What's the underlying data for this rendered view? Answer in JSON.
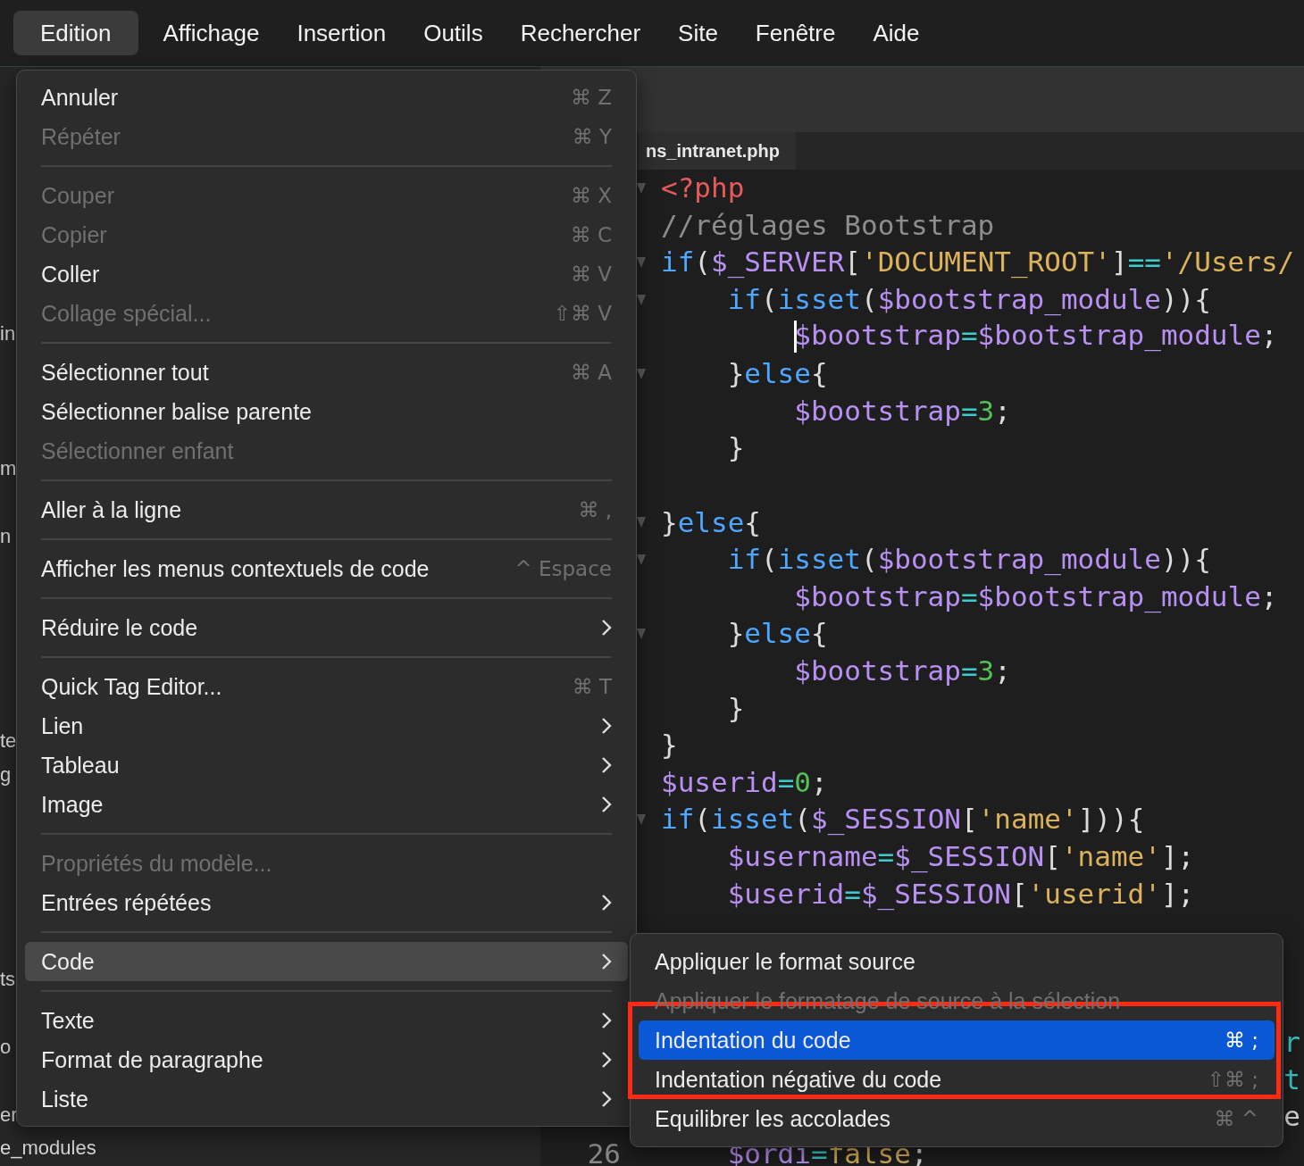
{
  "menubar": [
    {
      "label": "Edition",
      "selected": true
    },
    {
      "label": "Affichage",
      "selected": false
    },
    {
      "label": "Insertion",
      "selected": false
    },
    {
      "label": "Outils",
      "selected": false
    },
    {
      "label": "Rechercher",
      "selected": false
    },
    {
      "label": "Site",
      "selected": false
    },
    {
      "label": "Fenêtre",
      "selected": false
    },
    {
      "label": "Aide",
      "selected": false
    }
  ],
  "sidebar": {
    "items": [
      "in",
      "m",
      "n",
      "te",
      "g",
      "ts",
      "o",
      "er",
      "e_modules"
    ]
  },
  "editor": {
    "tab": {
      "label": "ns_intranet.php"
    },
    "lines": [
      {
        "fold": true,
        "tokens": [
          {
            "kind": "tag",
            "text": "<?php"
          }
        ]
      },
      {
        "fold": false,
        "tokens": [
          {
            "kind": "comment",
            "text": "//réglages Bootstrap"
          }
        ]
      },
      {
        "fold": true,
        "tokens": [
          {
            "kind": "keyword",
            "text": "if"
          },
          {
            "kind": "punct",
            "text": "("
          },
          {
            "kind": "variable",
            "text": "$_SERVER"
          },
          {
            "kind": "punct",
            "text": "["
          },
          {
            "kind": "string",
            "text": "'DOCUMENT_ROOT'"
          },
          {
            "kind": "punct",
            "text": "]"
          },
          {
            "kind": "operator",
            "text": "=="
          },
          {
            "kind": "string",
            "text": "'/Users/"
          }
        ],
        "children": [
          {
            "fold": true,
            "tokens": [
              {
                "kind": "keyword",
                "text": "if"
              },
              {
                "kind": "punct",
                "text": "("
              },
              {
                "kind": "keyword",
                "text": "isset"
              },
              {
                "kind": "punct",
                "text": "("
              },
              {
                "kind": "variable",
                "text": "$bootstrap_module"
              },
              {
                "kind": "punct",
                "text": ")){"
              }
            ],
            "children": [
              {
                "fold": false,
                "cursor": true,
                "tokens": [
                  {
                    "kind": "variable",
                    "text": "$bootstrap"
                  },
                  {
                    "kind": "operator",
                    "text": "="
                  },
                  {
                    "kind": "variable",
                    "text": "$bootstrap_module"
                  },
                  {
                    "kind": "punct",
                    "text": ";"
                  }
                ]
              }
            ]
          },
          {
            "fold": true,
            "tokens": [
              {
                "kind": "punct",
                "text": "}"
              },
              {
                "kind": "keyword",
                "text": "else"
              },
              {
                "kind": "punct",
                "text": "{"
              }
            ],
            "children": [
              {
                "fold": false,
                "tokens": [
                  {
                    "kind": "variable",
                    "text": "$bootstrap"
                  },
                  {
                    "kind": "operator",
                    "text": "="
                  },
                  {
                    "kind": "number",
                    "text": "3"
                  },
                  {
                    "kind": "punct",
                    "text": ";"
                  }
                ]
              }
            ]
          },
          {
            "fold": false,
            "tokens": [
              {
                "kind": "punct",
                "text": "}"
              }
            ]
          }
        ]
      },
      {
        "fold": true,
        "tokens": [
          {
            "kind": "punct",
            "text": "}"
          },
          {
            "kind": "keyword",
            "text": "else"
          },
          {
            "kind": "punct",
            "text": "{"
          }
        ],
        "children": [
          {
            "fold": true,
            "tokens": [
              {
                "kind": "keyword",
                "text": "if"
              },
              {
                "kind": "punct",
                "text": "("
              },
              {
                "kind": "keyword",
                "text": "isset"
              },
              {
                "kind": "punct",
                "text": "("
              },
              {
                "kind": "variable",
                "text": "$bootstrap_module"
              },
              {
                "kind": "punct",
                "text": ")){"
              }
            ],
            "children": [
              {
                "fold": false,
                "tokens": [
                  {
                    "kind": "variable",
                    "text": "$bootstrap"
                  },
                  {
                    "kind": "operator",
                    "text": "="
                  },
                  {
                    "kind": "variable",
                    "text": "$bootstrap_module"
                  },
                  {
                    "kind": "punct",
                    "text": ";"
                  }
                ]
              }
            ]
          },
          {
            "fold": true,
            "tokens": [
              {
                "kind": "punct",
                "text": "}"
              },
              {
                "kind": "keyword",
                "text": "else"
              },
              {
                "kind": "punct",
                "text": "{"
              }
            ],
            "children": [
              {
                "fold": false,
                "tokens": [
                  {
                    "kind": "variable",
                    "text": "$bootstrap"
                  },
                  {
                    "kind": "operator",
                    "text": "="
                  },
                  {
                    "kind": "number",
                    "text": "3"
                  },
                  {
                    "kind": "punct",
                    "text": ";"
                  }
                ]
              }
            ]
          },
          {
            "fold": false,
            "tokens": [
              {
                "kind": "punct",
                "text": "}"
              }
            ]
          }
        ]
      },
      {
        "fold": false,
        "tokens": [
          {
            "kind": "punct",
            "text": "}"
          }
        ]
      },
      {
        "fold": false,
        "tokens": [
          {
            "kind": "variable",
            "text": "$userid"
          },
          {
            "kind": "operator",
            "text": "="
          },
          {
            "kind": "number",
            "text": "0"
          },
          {
            "kind": "punct",
            "text": ";"
          }
        ]
      },
      {
        "fold": true,
        "tokens": [
          {
            "kind": "keyword",
            "text": "if"
          },
          {
            "kind": "punct",
            "text": "("
          },
          {
            "kind": "keyword",
            "text": "isset"
          },
          {
            "kind": "punct",
            "text": "("
          },
          {
            "kind": "variable",
            "text": "$_SESSION"
          },
          {
            "kind": "punct",
            "text": "["
          },
          {
            "kind": "string",
            "text": "'name'"
          },
          {
            "kind": "punct",
            "text": "])){"
          }
        ],
        "children": [
          {
            "fold": false,
            "tokens": [
              {
                "kind": "variable",
                "text": "$username"
              },
              {
                "kind": "operator",
                "text": "="
              },
              {
                "kind": "variable",
                "text": "$_SESSION"
              },
              {
                "kind": "punct",
                "text": "["
              },
              {
                "kind": "string",
                "text": "'name'"
              },
              {
                "kind": "punct",
                "text": "];"
              }
            ]
          },
          {
            "fold": false,
            "tokens": [
              {
                "kind": "variable",
                "text": "$userid"
              },
              {
                "kind": "operator",
                "text": "="
              },
              {
                "kind": "variable",
                "text": "$_SESSION"
              },
              {
                "kind": "punct",
                "text": "["
              },
              {
                "kind": "string",
                "text": "'userid'"
              },
              {
                "kind": "punct",
                "text": "];"
              }
            ]
          }
        ]
      },
      {
        "fold": false,
        "edge": {
          "kind": "operator",
          "text": "r"
        }
      },
      {
        "fold": false,
        "edge": {
          "kind": "operator",
          "text": "t"
        }
      },
      {
        "fold": false,
        "edge": {
          "kind": "punct",
          "text": "e"
        },
        "children": [
          {
            "fold": false,
            "number": "26",
            "tokens": [
              {
                "kind": "variable",
                "text": "$ordi"
              },
              {
                "kind": "operator",
                "text": "="
              },
              {
                "kind": "string",
                "text": "false"
              },
              {
                "kind": "punct",
                "text": ";"
              }
            ]
          }
        ]
      }
    ]
  },
  "menu": [
    {
      "kind": "item",
      "label": "Annuler",
      "shortcut": "⌘ Z",
      "disabled": false,
      "submenu": false,
      "selected": false
    },
    {
      "kind": "item",
      "label": "Répéter",
      "shortcut": "⌘ Y",
      "disabled": true,
      "submenu": false,
      "selected": false
    },
    {
      "kind": "separator"
    },
    {
      "kind": "item",
      "label": "Couper",
      "shortcut": "⌘ X",
      "disabled": true,
      "submenu": false,
      "selected": false
    },
    {
      "kind": "item",
      "label": "Copier",
      "shortcut": "⌘ C",
      "disabled": true,
      "submenu": false,
      "selected": false
    },
    {
      "kind": "item",
      "label": "Coller",
      "shortcut": "⌘ V",
      "disabled": false,
      "submenu": false,
      "selected": false
    },
    {
      "kind": "item",
      "label": "Collage spécial...",
      "shortcut": "⇧⌘ V",
      "disabled": true,
      "submenu": false,
      "selected": false
    },
    {
      "kind": "separator"
    },
    {
      "kind": "item",
      "label": "Sélectionner tout",
      "shortcut": "⌘ A",
      "disabled": false,
      "submenu": false,
      "selected": false
    },
    {
      "kind": "item",
      "label": "Sélectionner balise parente",
      "disabled": false,
      "submenu": false,
      "selected": false
    },
    {
      "kind": "item",
      "label": "Sélectionner enfant",
      "disabled": true,
      "submenu": false,
      "selected": false
    },
    {
      "kind": "separator"
    },
    {
      "kind": "item",
      "label": "Aller à la ligne",
      "shortcut": "⌘ ,",
      "disabled": false,
      "submenu": false,
      "selected": false
    },
    {
      "kind": "separator"
    },
    {
      "kind": "item",
      "label": "Afficher les menus contextuels de code",
      "shortcut": "^ Espace",
      "disabled": false,
      "submenu": false,
      "selected": false
    },
    {
      "kind": "separator"
    },
    {
      "kind": "item",
      "label": "Réduire le code",
      "disabled": false,
      "submenu": true,
      "selected": false
    },
    {
      "kind": "separator"
    },
    {
      "kind": "item",
      "label": "Quick Tag Editor...",
      "shortcut": "⌘ T",
      "disabled": false,
      "submenu": false,
      "selected": false
    },
    {
      "kind": "item",
      "label": "Lien",
      "disabled": false,
      "submenu": true,
      "selected": false
    },
    {
      "kind": "item",
      "label": "Tableau",
      "disabled": false,
      "submenu": true,
      "selected": false
    },
    {
      "kind": "item",
      "label": "Image",
      "disabled": false,
      "submenu": true,
      "selected": false
    },
    {
      "kind": "separator"
    },
    {
      "kind": "item",
      "label": "Propriétés du modèle...",
      "disabled": true,
      "submenu": false,
      "selected": false
    },
    {
      "kind": "item",
      "label": "Entrées répétées",
      "disabled": false,
      "submenu": true,
      "selected": false
    },
    {
      "kind": "separator"
    },
    {
      "kind": "item",
      "label": "Code",
      "disabled": false,
      "submenu": true,
      "selected": true
    },
    {
      "kind": "separator"
    },
    {
      "kind": "item",
      "label": "Texte",
      "disabled": false,
      "submenu": true,
      "selected": false
    },
    {
      "kind": "item",
      "label": "Format de paragraphe",
      "disabled": false,
      "submenu": true,
      "selected": false
    },
    {
      "kind": "item",
      "label": "Liste",
      "disabled": false,
      "submenu": true,
      "selected": false
    }
  ],
  "submenu": [
    {
      "kind": "item",
      "label": "Appliquer le format source",
      "disabled": false,
      "selected": false
    },
    {
      "kind": "item",
      "label": "Appliquer le formatage de source à la sélection",
      "disabled": true,
      "selected": false
    },
    {
      "kind": "item",
      "label": "Indentation du code",
      "shortcut": "⌘ ;",
      "disabled": false,
      "selected": true
    },
    {
      "kind": "item",
      "label": "Indentation négative du code",
      "shortcut": "⇧⌘ ;",
      "disabled": false,
      "selected": false
    },
    {
      "kind": "item",
      "label": "Equilibrer les accolades",
      "shortcut": "⌘ ^",
      "disabled": false,
      "selected": false
    }
  ],
  "annotation_frame": {
    "shown": true
  }
}
